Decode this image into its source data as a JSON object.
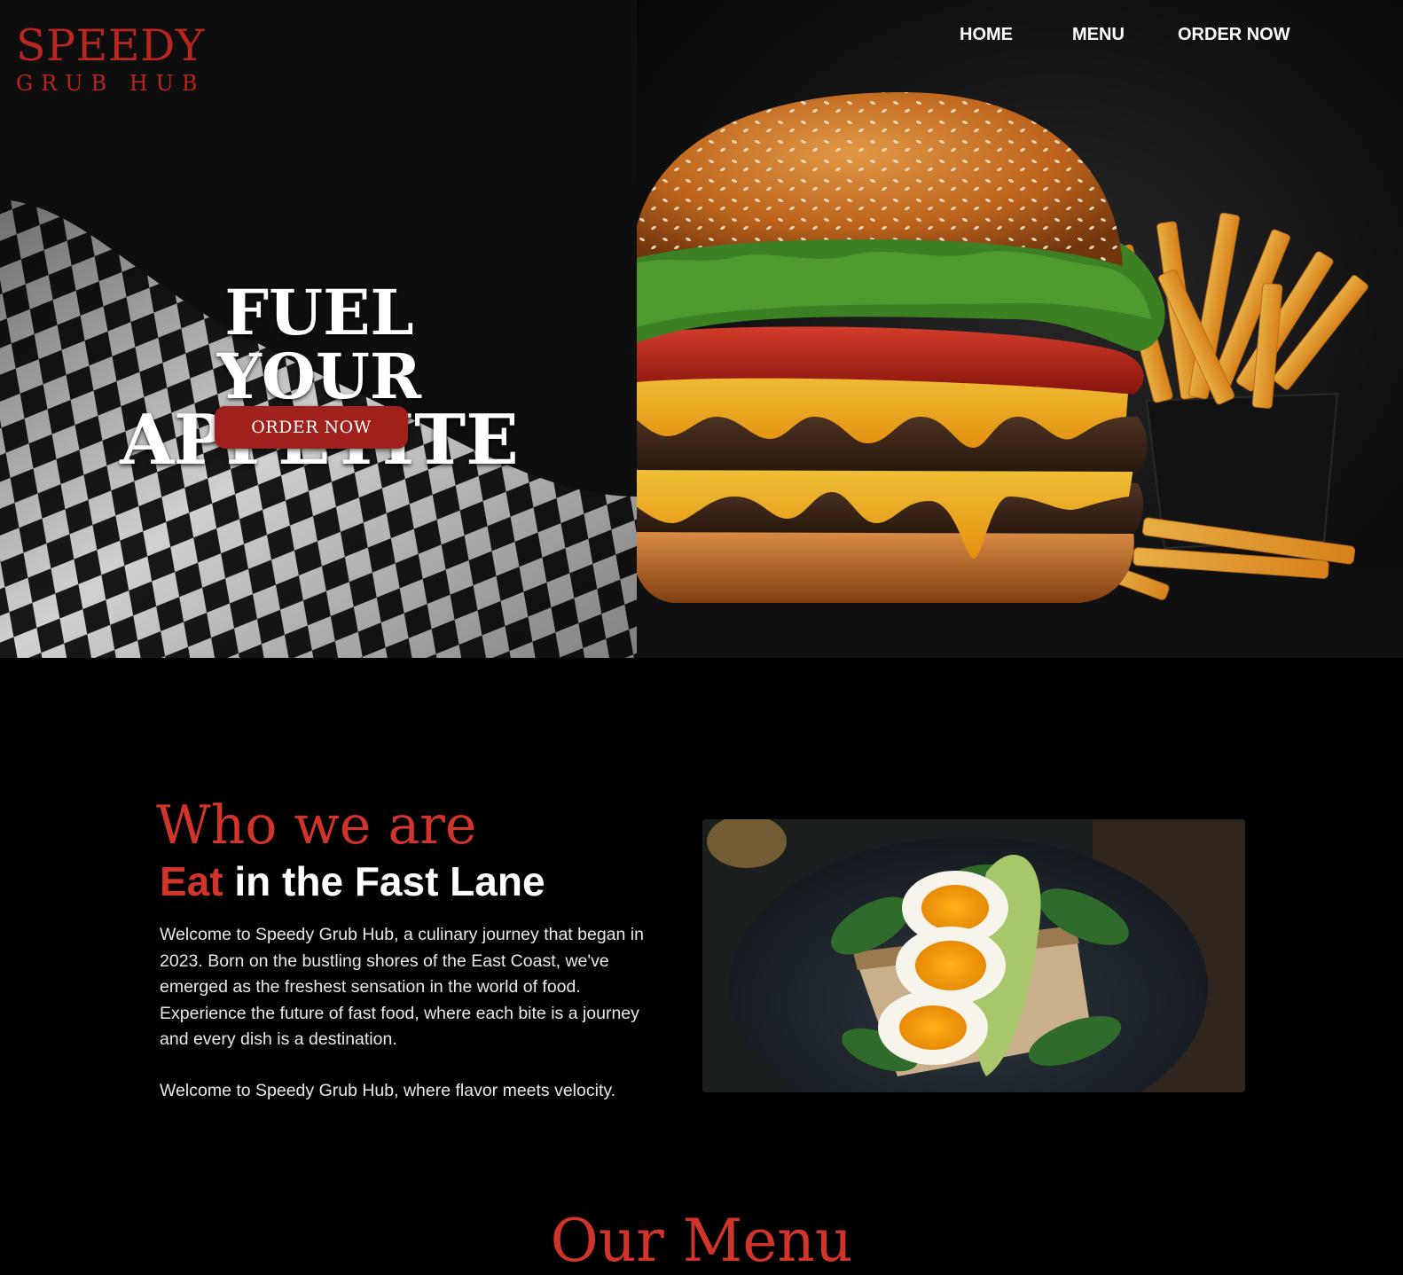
{
  "brand": {
    "name": "SPEEDY",
    "tagline": "GRUB HUB",
    "accent_color": "#b9251f"
  },
  "nav": {
    "items": [
      {
        "label": "HOME"
      },
      {
        "label": "MENU"
      },
      {
        "label": "ORDER NOW"
      }
    ]
  },
  "hero": {
    "title_line1": "FUEL YOUR",
    "title_line2": "APPETITE",
    "cta_label": "ORDER NOW",
    "image_subject": "burger-and-fries-image"
  },
  "about": {
    "heading": "Who we are",
    "subheading_accent": "Eat",
    "subheading_rest": " in the Fast Lane",
    "paragraphs": [
      "Welcome to Speedy Grub Hub, a culinary journey that began in 2023. Born on the bustling shores of the East Coast, we've emerged as the freshest sensation in the world of food. Experience the future of fast food, where each bite is a journey and every dish is a destination.",
      "Welcome to Speedy Grub Hub, where flavor meets velocity."
    ],
    "image_subject": "egg-avocado-toast-image"
  },
  "menu": {
    "heading": "Our Menu"
  },
  "colors": {
    "background": "#000000",
    "heading_red": "#d3342a",
    "button_red": "#a0201b"
  }
}
